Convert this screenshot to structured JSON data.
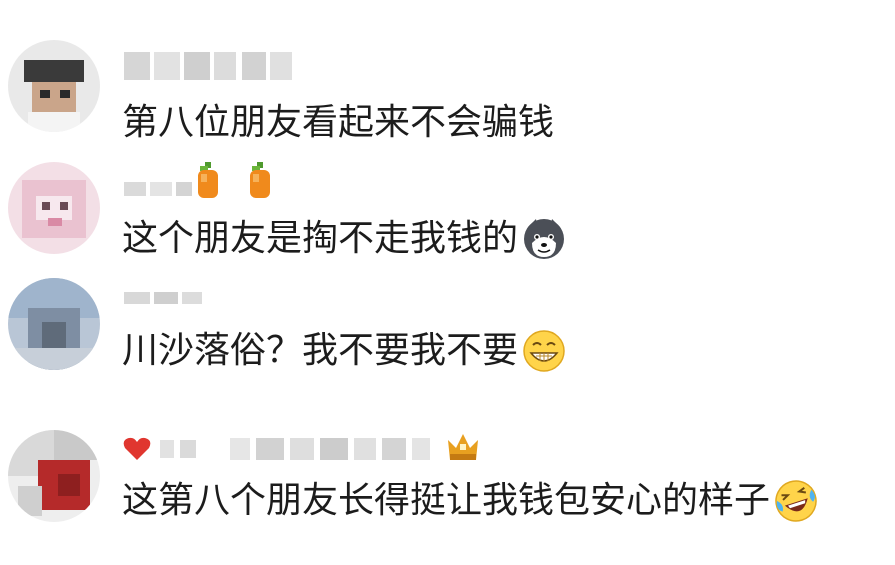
{
  "comments": [
    {
      "username": "",
      "text": "第八位朋友看起来不会骗钱",
      "emoji": null,
      "badges": []
    },
    {
      "username": "",
      "text": "这个朋友是掏不走我钱的",
      "emoji": "husky-doge-emoji",
      "badges": [
        "orange-fruit-icon",
        "orange-fruit-icon"
      ]
    },
    {
      "username": "",
      "text": "川沙落俗？我不要我不要",
      "emoji": "grinning-teeth-emoji",
      "badges": []
    },
    {
      "username": "",
      "text": "这第八个朋友长得挺让我钱包安心的样子",
      "emoji": "laughing-tears-emoji",
      "badges": [
        "heart-icon",
        "crown-icon"
      ]
    }
  ],
  "colors": {
    "text": "#1c1c1c",
    "blur_gray": "#d8d8d8",
    "heart": "#e0362f",
    "crown": "#e8a020",
    "orange": "#f08a1c"
  }
}
